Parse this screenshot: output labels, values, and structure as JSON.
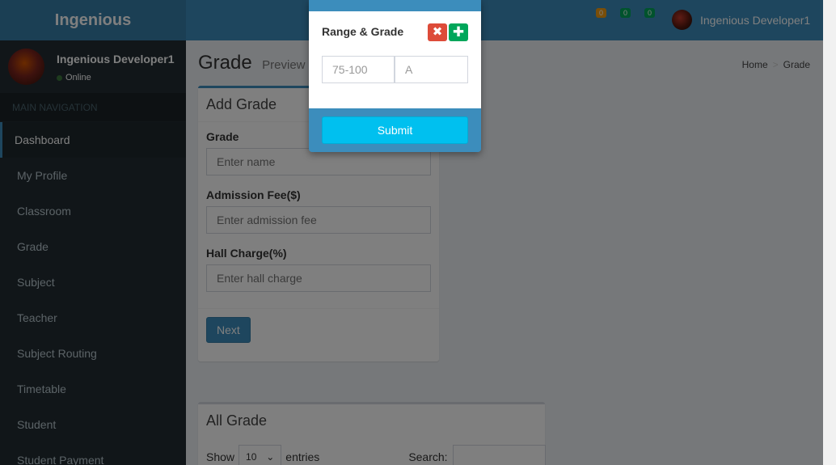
{
  "app": {
    "logo": "Ingenious",
    "toggle_icon": ""
  },
  "header": {
    "badges": [
      "0",
      "0",
      "0"
    ],
    "user_name": "Ingenious Developer1"
  },
  "sidebar": {
    "user_name": "Ingenious Developer1",
    "status": "Online",
    "nav_header": "MAIN NAVIGATION",
    "items": [
      {
        "label": "Dashboard"
      },
      {
        "label": "My Profile"
      },
      {
        "label": "Classroom"
      },
      {
        "label": "Grade"
      },
      {
        "label": "Subject"
      },
      {
        "label": "Teacher"
      },
      {
        "label": "Subject Routing"
      },
      {
        "label": "Timetable"
      },
      {
        "label": "Student"
      },
      {
        "label": "Student Payment"
      }
    ]
  },
  "content": {
    "title": "Grade",
    "subtitle": "Preview",
    "breadcrumb": {
      "home": "Home",
      "sep": ">",
      "current": "Grade"
    }
  },
  "add_grade": {
    "title": "Add Grade",
    "grade_label": "Grade",
    "grade_placeholder": "Enter name",
    "fee_label": "Admission Fee($)",
    "fee_placeholder": "Enter admission fee",
    "hall_label": "Hall Charge(%)",
    "hall_placeholder": "Enter hall charge",
    "next_label": "Next"
  },
  "all_grade": {
    "title": "All Grade",
    "show_label": "Show",
    "entries_value": "10",
    "entries_label": "entries",
    "search_label": "Search:"
  },
  "modal": {
    "title": "Range & Grade",
    "remove_icon": "✖",
    "add_icon": "✚",
    "range_placeholder": "75-100",
    "grade_placeholder": "A",
    "submit_label": "Submit"
  },
  "colors": {
    "primary": "#3c8dbc",
    "sidebar": "#222d32",
    "danger": "#dd4b39",
    "success": "#00a65a",
    "info": "#00c0ef"
  }
}
